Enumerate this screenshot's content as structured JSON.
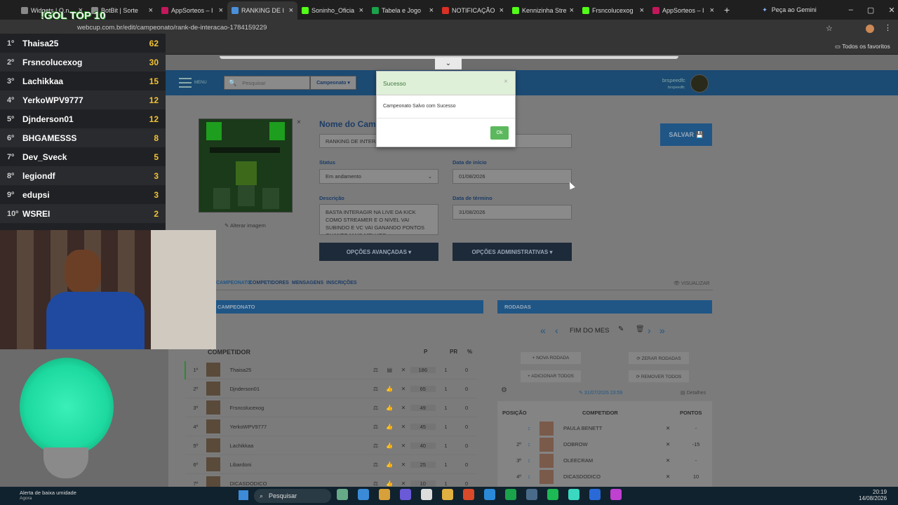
{
  "browser": {
    "tabs": [
      {
        "label": "Widgets | O.n",
        "color": "#888"
      },
      {
        "label": "BotBit | Sorte",
        "color": "#888"
      },
      {
        "label": "AppSorteos – I",
        "color": "#c2185b"
      },
      {
        "label": "RANKING DE I",
        "color": "#4a90d9"
      },
      {
        "label": "Soninho_Oficia",
        "color": "#53fc18"
      },
      {
        "label": "Tabela e Jogo",
        "color": "#1aa34a"
      },
      {
        "label": "NOTIFICAÇÃO",
        "color": "#d93025"
      },
      {
        "label": "Kennizinha Stre",
        "color": "#53fc18"
      },
      {
        "label": "Frsncolucexog",
        "color": "#53fc18"
      },
      {
        "label": "AppSorteos – I",
        "color": "#c2185b"
      }
    ],
    "gemini": "Peça ao Gemini",
    "url": "webcup.com.br/edit/campeonato/rank-de-interacao-1784159229",
    "favorites": "Todos os favoritos"
  },
  "overlay": {
    "title": "!GOL TOP 10",
    "ranking": [
      {
        "pos": "1º",
        "name": "Thaisa25",
        "score": "62"
      },
      {
        "pos": "2º",
        "name": "Frsncolucexog",
        "score": "30"
      },
      {
        "pos": "3º",
        "name": "Lachikkaa",
        "score": "15"
      },
      {
        "pos": "4º",
        "name": "YerkoWPV9777",
        "score": "12"
      },
      {
        "pos": "5º",
        "name": "Djnderson01",
        "score": "12"
      },
      {
        "pos": "6º",
        "name": "BHGAMESSS",
        "score": "8"
      },
      {
        "pos": "7º",
        "name": "Dev_Sveck",
        "score": "5"
      },
      {
        "pos": "8º",
        "name": "legiondf",
        "score": "3"
      },
      {
        "pos": "9º",
        "name": "edupsi",
        "score": "3"
      },
      {
        "pos": "10º",
        "name": "WSREI",
        "score": "2"
      }
    ]
  },
  "nav": {
    "menu": "MENU",
    "search_placeholder": "Pesquisar",
    "campeonato": "Campeonato ▾",
    "user": "brspeedfc",
    "user_sub": "brspeedfc"
  },
  "form": {
    "image_alter": "Alterar imagem",
    "name_label": "Nome do Cam",
    "name_value": "RANKING DE INTERAÇ",
    "status_label": "Status",
    "status_value": "Em andamento",
    "start_label": "Data de início",
    "start_value": "01/08/2026",
    "end_label": "Data de término",
    "end_value": "31/08/2026",
    "desc_label": "Descrição",
    "desc_value": "BASTA INTERAGIR NA LIVE DA KICK COMO STREAMER E O NIVEL VAI SUBINDO E VC VAI GANANDO PONTOS QUANTO MAIS MELHOR...",
    "adv_btn": "OPÇÕES AVANÇADAS ▾",
    "admin_btn": "OPÇÕES ADMINISTRATIVAS ▾",
    "save_btn": "SALVAR 💾"
  },
  "tabs": {
    "t1": "CAMPEONATO",
    "t2": "COMPETIDORES",
    "t3": "MENSAGENS",
    "t4": "INSCRIÇÕES",
    "view": "👁 VISUALIZAR"
  },
  "comp": {
    "bar": "CAMPEONATO",
    "h_comp": "COMPETIDOR",
    "h_p": "P",
    "h_pr": "PR",
    "h_pct": "%",
    "rows": [
      {
        "pos": "1º",
        "name": "Thaisa25",
        "p": "186",
        "pr": "1",
        "pct": "0"
      },
      {
        "pos": "2º",
        "name": "Djnderson01",
        "p": "65",
        "pr": "1",
        "pct": "0"
      },
      {
        "pos": "3º",
        "name": "Frsncolucexog",
        "p": "49",
        "pr": "1",
        "pct": "0"
      },
      {
        "pos": "4º",
        "name": "YerkoWPV9777",
        "p": "45",
        "pr": "1",
        "pct": "0"
      },
      {
        "pos": "5º",
        "name": "Lachikkaa",
        "p": "40",
        "pr": "1",
        "pct": "0"
      },
      {
        "pos": "6º",
        "name": "Libardoni",
        "p": "25",
        "pr": "1",
        "pct": "0"
      },
      {
        "pos": "7º",
        "name": "DICASDODICO",
        "p": "10",
        "pr": "1",
        "pct": "0"
      }
    ]
  },
  "rounds": {
    "bar": "RODADAS",
    "round_name": "FIM DO MES",
    "new": "+ NOVA RODADA",
    "reset": "⟳ ZERAR RODADAS",
    "add_all": "+ ADICIONAR TODOS",
    "remove_all": "⟳ REMOVER TODOS",
    "date": "✎ 31/07/2026 23:59",
    "details": "Detalhes",
    "h_pos": "POSIÇÃO",
    "h_comp": "COMPETIDOR",
    "h_pts": "PONTOS",
    "rows": [
      {
        "pos": "",
        "name": "PAULA BENETT",
        "pts": "-"
      },
      {
        "pos": "2º",
        "name": "DOBROW",
        "pts": "-15"
      },
      {
        "pos": "3º",
        "name": "OLEECRAM",
        "pts": "-"
      },
      {
        "pos": "4º",
        "name": "DICASDODICO",
        "pts": "10"
      }
    ]
  },
  "modal": {
    "title": "Sucesso",
    "message": "Campeonato Salvo com Sucesso",
    "ok": "Ok"
  },
  "taskbar": {
    "weather": "Alerta de baixa umidade",
    "weather_sub": "Agora",
    "search": "Pesquisar",
    "time": "20:19",
    "date": "14/08/2026"
  }
}
